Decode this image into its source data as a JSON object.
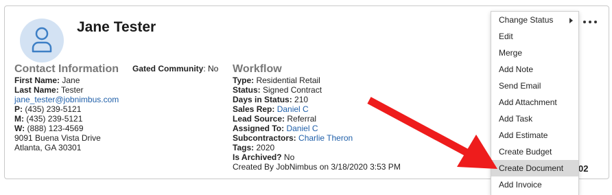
{
  "contact": {
    "name": "Jane Tester"
  },
  "contact_info": {
    "heading": "Contact Information",
    "first_name_label": "First Name:",
    "first_name": "Jane",
    "last_name_label": "Last Name:",
    "last_name": "Tester",
    "email": "jane_tester@jobnimbus.com",
    "phone_p_label": "P:",
    "phone_p": "(435) 239-5121",
    "phone_m_label": "M:",
    "phone_m": "(435) 239-5121",
    "phone_w_label": "W:",
    "phone_w": "(888) 123-4569",
    "address_line1": "9091 Buena Vista Drive",
    "address_line2": "Atlanta, GA 30301"
  },
  "gated": {
    "label": "Gated Community",
    "value": ": No"
  },
  "workflow": {
    "heading": "Workflow",
    "type_label": "Type:",
    "type": "Residential Retail",
    "status_label": "Status:",
    "status": "Signed Contract",
    "days_label": "Days in Status:",
    "days": "210",
    "sales_rep_label": "Sales Rep:",
    "sales_rep": "Daniel C",
    "lead_source_label": "Lead Source:",
    "lead_source": "Referral",
    "assigned_label": "Assigned To:",
    "assigned": "Daniel C",
    "subcontractors_label": "Subcontractors:",
    "subcontractors": "Charlie Theron",
    "tags_label": "Tags:",
    "tags": "2020",
    "archived_label": "Is Archived?",
    "archived": "No",
    "created_by": "Created By JobNimbus on 3/18/2020 3:53 PM"
  },
  "partial_text": "02",
  "actions_menu": {
    "items": [
      {
        "label": "Change Status"
      },
      {
        "label": "Edit"
      },
      {
        "label": "Merge"
      },
      {
        "label": "Add Note"
      },
      {
        "label": "Send Email"
      },
      {
        "label": "Add Attachment"
      },
      {
        "label": "Add Task"
      },
      {
        "label": "Add Estimate"
      },
      {
        "label": "Create Budget"
      },
      {
        "label": "Create Document"
      },
      {
        "label": "Add Invoice"
      }
    ],
    "active_label": "Create Document"
  },
  "colors": {
    "link": "#1f5fa9",
    "heading_gray": "#777777",
    "avatar_bg": "#d3e2f3",
    "avatar_icon": "#3d7fc5",
    "arrow": "#ee1c1c",
    "menu_active_bg": "#d9d9d9"
  },
  "icons": {
    "avatar": "user-icon",
    "more": "more-horizontal-icon",
    "submenu": "caret-right-icon"
  }
}
